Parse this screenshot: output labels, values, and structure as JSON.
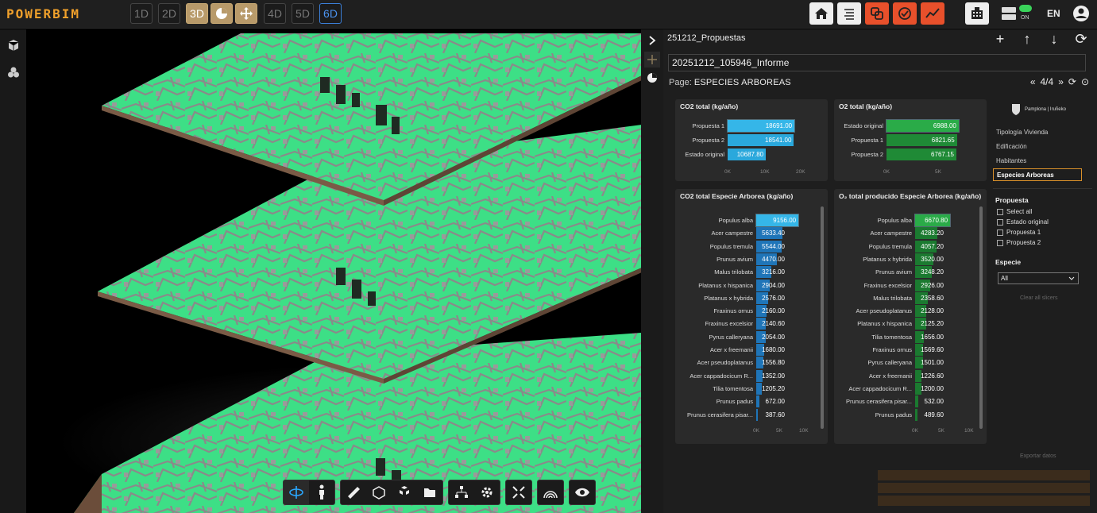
{
  "app": {
    "logo": "POWERBIM",
    "lang": "EN",
    "toggle": "ON"
  },
  "dims": [
    "1D",
    "2D",
    "3D",
    "4D",
    "5D",
    "6D"
  ],
  "panel": {
    "title": "251212_Propuestas",
    "report": "20251212_105946_Informe",
    "page_label": "Page:",
    "page_name": "ESPECIES ARBOREAS",
    "page_counter": "4/4"
  },
  "cards": {
    "co2_total": {
      "title": "CO2 total (kg/año)",
      "ticks": [
        "0K",
        "10K",
        "20K"
      ]
    },
    "o2_total": {
      "title": "O2 total (kg/año)",
      "ticks": [
        "0K",
        "5K"
      ]
    },
    "co2_species": {
      "title": "CO2 total Especie Arborea (kg/año)",
      "ticks": [
        "0K",
        "5K",
        "10K"
      ]
    },
    "o2_species": {
      "title": "O₂ total producido Especie Arborea (kg/año)",
      "ticks": [
        "0K",
        "5K",
        "10K"
      ]
    }
  },
  "chart_data": [
    {
      "type": "bar",
      "title": "CO2 total (kg/año)",
      "categories": [
        "Propuesta 1",
        "Propuesta 2",
        "Estado original"
      ],
      "values": [
        18691.0,
        18541.0,
        10687.8
      ],
      "labels": [
        "18691.00",
        "18541.00",
        "10687.80"
      ],
      "xlim": [
        0,
        20000
      ]
    },
    {
      "type": "bar",
      "title": "O2 total (kg/año)",
      "categories": [
        "Estado original",
        "Propuesta 1",
        "Propuesta 2"
      ],
      "values": [
        6988.0,
        6821.65,
        6767.15
      ],
      "labels": [
        "6988.00",
        "6821.65",
        "6767.15"
      ],
      "xlim": [
        0,
        8000
      ]
    },
    {
      "type": "bar",
      "title": "CO2 total Especie Arborea (kg/año)",
      "categories": [
        "Populus alba",
        "Acer campestre",
        "Populus tremula",
        "Prunus avium",
        "Malus trilobata",
        "Platanus x hispanica",
        "Platanus x hybrida",
        "Fraxinus ornus",
        "Fraxinus excelsior",
        "Pyrus calleryana",
        "Acer x freemanii",
        "Acer pseudoplatanus",
        "Acer cappadocicum R...",
        "Tilia tomentosa",
        "Prunus padus",
        "Prunus cerasifera pisar..."
      ],
      "values": [
        9156.0,
        5633.4,
        5544.0,
        4470.0,
        3216.0,
        2904.0,
        2576.0,
        2160.0,
        2140.6,
        2054.0,
        1680.0,
        1556.8,
        1352.0,
        1205.2,
        672.0,
        387.6
      ],
      "labels": [
        "9156.00",
        "5633.40",
        "5544.00",
        "4470.00",
        "3216.00",
        "2904.00",
        "2576.00",
        "2160.00",
        "2140.60",
        "2054.00",
        "1680.00",
        "1556.80",
        "1352.00",
        "1205.20",
        "672.00",
        "387.60"
      ],
      "xlim": [
        0,
        10000
      ]
    },
    {
      "type": "bar",
      "title": "O₂ total producido Especie Arborea (kg/año)",
      "categories": [
        "Populus alba",
        "Acer campestre",
        "Populus tremula",
        "Platanus x hybrida",
        "Prunus avium",
        "Fraxinus excelsior",
        "Malus trilobata",
        "Acer pseudoplatanus",
        "Platanus x hispanica",
        "Tilia tomentosa",
        "Fraxinus ornus",
        "Pyrus calleryana",
        "Acer x freemanii",
        "Acer cappadocicum R...",
        "Prunus cerasifera pisar...",
        "Prunus padus"
      ],
      "values": [
        6670.8,
        4283.2,
        4057.2,
        3520.0,
        3248.2,
        2926.0,
        2358.6,
        2128.0,
        2125.2,
        1656.0,
        1569.6,
        1501.0,
        1226.6,
        1200.0,
        532.0,
        489.6
      ],
      "labels": [
        "6670.80",
        "4283.20",
        "4057.20",
        "3520.00",
        "3248.20",
        "2926.00",
        "2358.60",
        "2128.00",
        "2125.20",
        "1656.00",
        "1569.60",
        "1501.00",
        "1226.60",
        "1200.00",
        "532.00",
        "489.60"
      ],
      "xlim": [
        0,
        10000
      ]
    }
  ],
  "nav": {
    "items": [
      "Tipología Vivienda",
      "Edificación",
      "Habitantes",
      "Especies Arboreas"
    ],
    "selected": 3
  },
  "slicers": {
    "propuesta_title": "Propuesta",
    "propuesta_options": [
      "Select all",
      "Estado original",
      "Propuesta 1",
      "Propuesta 2"
    ],
    "especie_title": "Especie",
    "especie_value": "All",
    "clear": "Clear all slicers"
  },
  "export": "Exportar datos",
  "colors": {
    "accent": "#f0a02b",
    "blue": "#2aa8dc",
    "green": "#1f9a3e",
    "map_green": "#3ee08a"
  }
}
